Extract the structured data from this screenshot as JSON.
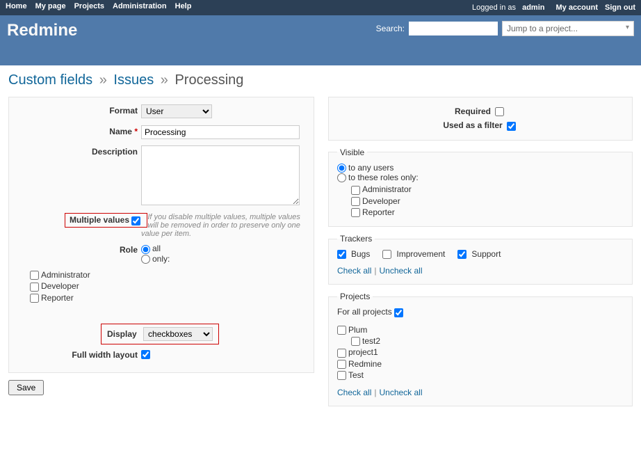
{
  "topmenu": {
    "home": "Home",
    "mypage": "My page",
    "projects": "Projects",
    "admin": "Administration",
    "help": "Help",
    "loggedin_prefix": "Logged in as ",
    "loggedin_user": "admin",
    "myaccount": "My account",
    "signout": "Sign out"
  },
  "header": {
    "title": "Redmine",
    "search_label": "Search:",
    "project_jump": "Jump to a project..."
  },
  "breadcrumb": {
    "a": "Custom fields",
    "b": "Issues",
    "c": "Processing"
  },
  "form": {
    "format_label": "Format",
    "format_value": "User",
    "name_label": "Name",
    "name_value": "Processing",
    "description_label": "Description",
    "description_value": "",
    "multiple_label": "Multiple values",
    "multiple_hint": "If you disable multiple values, multiple values will be removed in order to preserve only one value per item.",
    "role_label": "Role",
    "role_all": "all",
    "role_only": "only:",
    "roles": [
      "Administrator",
      "Developer",
      "Reporter"
    ],
    "display_label": "Display",
    "display_value": "checkboxes",
    "fullwidth_label": "Full width layout",
    "save": "Save"
  },
  "right": {
    "required_label": "Required",
    "filter_label": "Used as a filter",
    "visible_legend": "Visible",
    "visible_any": "to any users",
    "visible_roles": "to these roles only:",
    "visible_role_list": [
      "Administrator",
      "Developer",
      "Reporter"
    ],
    "trackers_legend": "Trackers",
    "trackers": [
      {
        "name": "Bugs",
        "checked": true
      },
      {
        "name": "Improvement",
        "checked": false
      },
      {
        "name": "Support",
        "checked": true
      }
    ],
    "check_all": "Check all",
    "uncheck_all": "Uncheck all",
    "projects_legend": "Projects",
    "for_all_label": "For all projects",
    "project_list": [
      {
        "name": "Plum",
        "indent": 0
      },
      {
        "name": "test2",
        "indent": 1
      },
      {
        "name": "project1",
        "indent": 0
      },
      {
        "name": "Redmine",
        "indent": 0
      },
      {
        "name": "Test",
        "indent": 0
      }
    ]
  }
}
